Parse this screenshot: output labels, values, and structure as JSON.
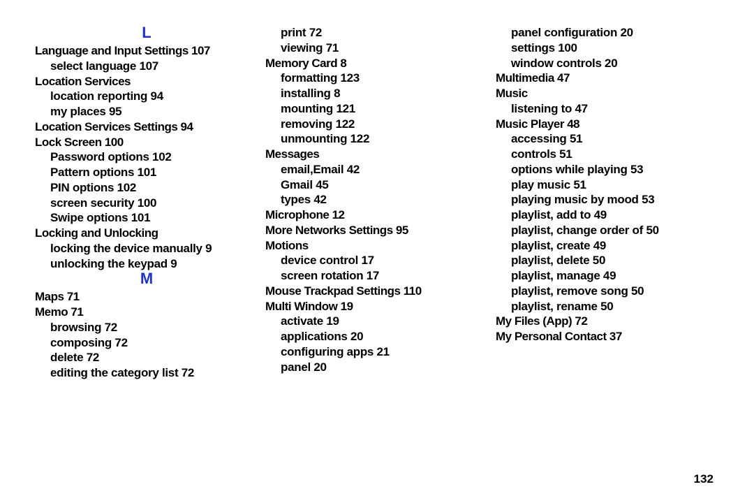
{
  "page_number": "132",
  "columns": [
    {
      "items": [
        {
          "type": "letter",
          "text": "L"
        },
        {
          "type": "topic",
          "term": "Language and Input Settings",
          "page": "107"
        },
        {
          "type": "sub",
          "term": "select language",
          "page": "107"
        },
        {
          "type": "topic",
          "term": "Location Services"
        },
        {
          "type": "sub",
          "term": "location reporting",
          "page": "94"
        },
        {
          "type": "sub",
          "term": "my places",
          "page": "95"
        },
        {
          "type": "topic",
          "term": "Location Services Settings",
          "page": "94"
        },
        {
          "type": "topic",
          "term": "Lock Screen",
          "page": "100"
        },
        {
          "type": "sub",
          "term": "Password options",
          "page": "102"
        },
        {
          "type": "sub",
          "term": "Pattern options",
          "page": "101"
        },
        {
          "type": "sub",
          "term": "PIN options",
          "page": "102"
        },
        {
          "type": "sub",
          "term": "screen security",
          "page": "100"
        },
        {
          "type": "sub",
          "term": "Swipe options",
          "page": "101"
        },
        {
          "type": "topic",
          "term": "Locking and Unlocking"
        },
        {
          "type": "sub",
          "term": "locking the device manually",
          "page": "9"
        },
        {
          "type": "sub",
          "term": "unlocking the keypad",
          "page": "9"
        },
        {
          "type": "letter",
          "text": "M"
        },
        {
          "type": "topic",
          "term": "Maps",
          "page": "71"
        },
        {
          "type": "topic",
          "term": "Memo",
          "page": "71"
        },
        {
          "type": "sub",
          "term": "browsing",
          "page": "72"
        },
        {
          "type": "sub",
          "term": "composing",
          "page": "72"
        },
        {
          "type": "sub",
          "term": "delete",
          "page": "72"
        },
        {
          "type": "sub",
          "term": "editing the category list",
          "page": "72"
        }
      ]
    },
    {
      "items": [
        {
          "type": "sub",
          "term": "print",
          "page": "72"
        },
        {
          "type": "sub",
          "term": "viewing",
          "page": "71"
        },
        {
          "type": "topic",
          "term": "Memory Card",
          "page": "8"
        },
        {
          "type": "sub",
          "term": "formatting",
          "page": "123"
        },
        {
          "type": "sub",
          "term": "installing",
          "page": "8"
        },
        {
          "type": "sub",
          "term": "mounting",
          "page": "121"
        },
        {
          "type": "sub",
          "term": "removing",
          "page": "122"
        },
        {
          "type": "sub",
          "term": "unmounting",
          "page": "122"
        },
        {
          "type": "topic",
          "term": "Messages"
        },
        {
          "type": "sub",
          "term": "email,Email",
          "page": "42"
        },
        {
          "type": "sub",
          "term": "Gmail",
          "page": "45"
        },
        {
          "type": "sub",
          "term": "types",
          "page": "42"
        },
        {
          "type": "topic",
          "term": "Microphone",
          "page": "12"
        },
        {
          "type": "topic",
          "term": "More Networks Settings",
          "page": "95"
        },
        {
          "type": "topic",
          "term": "Motions"
        },
        {
          "type": "sub",
          "term": "device control",
          "page": "17"
        },
        {
          "type": "sub",
          "term": "screen rotation",
          "page": "17"
        },
        {
          "type": "topic",
          "term": "Mouse Trackpad Settings",
          "page": "110"
        },
        {
          "type": "topic",
          "term": "Multi Window",
          "page": "19"
        },
        {
          "type": "sub",
          "term": "activate",
          "page": "19"
        },
        {
          "type": "sub",
          "term": "applications",
          "page": "20"
        },
        {
          "type": "sub",
          "term": "configuring apps",
          "page": "21"
        },
        {
          "type": "sub",
          "term": "panel",
          "page": "20"
        }
      ]
    },
    {
      "items": [
        {
          "type": "sub",
          "term": "panel configuration",
          "page": "20"
        },
        {
          "type": "sub",
          "term": "settings",
          "page": "100"
        },
        {
          "type": "sub",
          "term": "window controls",
          "page": "20"
        },
        {
          "type": "topic",
          "term": "Multimedia",
          "page": "47"
        },
        {
          "type": "topic",
          "term": "Music"
        },
        {
          "type": "sub",
          "term": "listening to",
          "page": "47"
        },
        {
          "type": "topic",
          "term": "Music Player",
          "page": "48"
        },
        {
          "type": "sub",
          "term": "accessing",
          "page": "51"
        },
        {
          "type": "sub",
          "term": "controls",
          "page": "51"
        },
        {
          "type": "sub",
          "term": "options while playing",
          "page": "53"
        },
        {
          "type": "sub",
          "term": "play music",
          "page": "51"
        },
        {
          "type": "sub",
          "term": "playing music by mood",
          "page": "53"
        },
        {
          "type": "sub",
          "term": "playlist, add to",
          "page": "49"
        },
        {
          "type": "sub",
          "term": "playlist, change order of",
          "page": "50"
        },
        {
          "type": "sub",
          "term": "playlist, create",
          "page": "49"
        },
        {
          "type": "sub",
          "term": "playlist, delete",
          "page": "50"
        },
        {
          "type": "sub",
          "term": "playlist, manage",
          "page": "49"
        },
        {
          "type": "sub",
          "term": "playlist, remove song",
          "page": "50"
        },
        {
          "type": "sub",
          "term": "playlist, rename",
          "page": "50"
        },
        {
          "type": "topic",
          "term": "My Files (App)",
          "page": "72"
        },
        {
          "type": "topic",
          "term": "My Personal Contact",
          "page": "37"
        }
      ]
    }
  ]
}
